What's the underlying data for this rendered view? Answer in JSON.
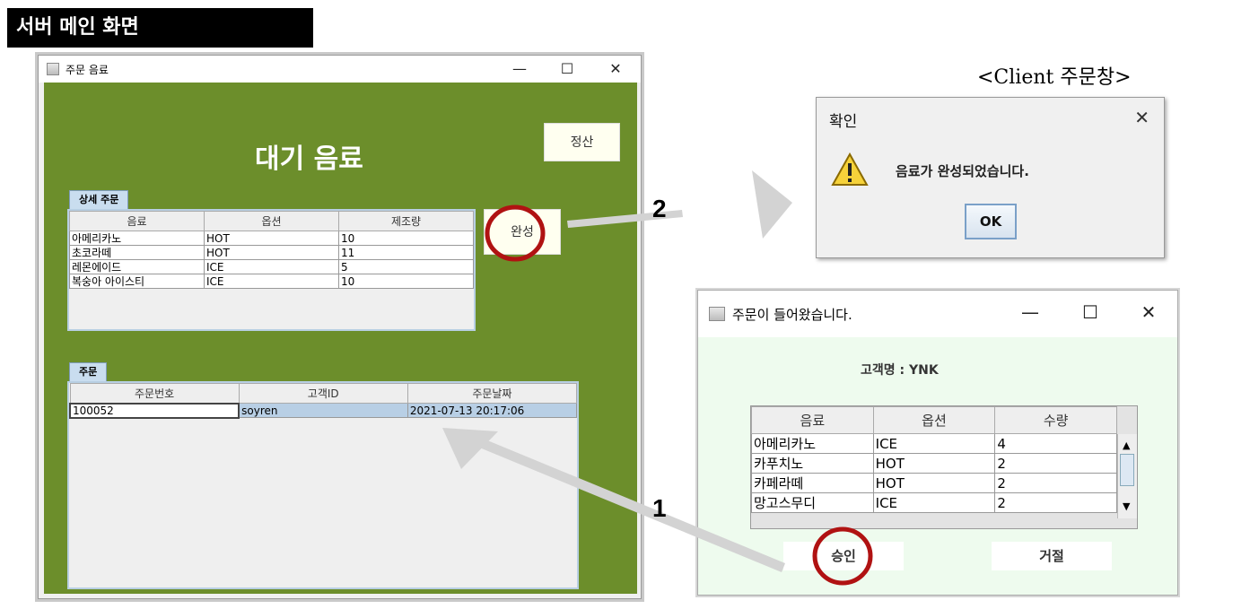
{
  "section_title": "서버 메인 화면",
  "server_window": {
    "title": "주문 음료",
    "controls": {
      "minimize": "—",
      "maximize": "☐",
      "close": "✕"
    },
    "heading": "대기 음료",
    "settle_button": "정산",
    "complete_button": "완성",
    "detail_tab": "상세 주문",
    "detail_columns": [
      "음료",
      "옵션",
      "제조량"
    ],
    "detail_rows": [
      [
        "아메리카노",
        "HOT",
        "10"
      ],
      [
        "초코라떼",
        "HOT",
        "11"
      ],
      [
        "레몬에이드",
        "ICE",
        "5"
      ],
      [
        "복숭아 아이스티",
        "ICE",
        "10"
      ]
    ],
    "order_tab": "주문",
    "order_columns": [
      "주문번호",
      "고객ID",
      "주문날짜"
    ],
    "order_rows": [
      [
        "100052",
        "soyren",
        "2021-07-13 20:17:06"
      ]
    ]
  },
  "client_label": "<Client 주문창>",
  "confirm_dialog": {
    "title": "확인",
    "close": "✕",
    "message": "음료가 완성되었습니다.",
    "ok_button": "OK"
  },
  "order_window": {
    "title": "주문이 들어왔습니다.",
    "controls": {
      "minimize": "—",
      "maximize": "☐",
      "close": "✕"
    },
    "customer": "고객명 : YNK",
    "columns": [
      "음료",
      "옵션",
      "수량"
    ],
    "rows": [
      [
        "아메리카노",
        "ICE",
        "4"
      ],
      [
        "카푸치노",
        "HOT",
        "2"
      ],
      [
        "카페라떼",
        "HOT",
        "2"
      ],
      [
        "망고스무디",
        "ICE",
        "2"
      ]
    ],
    "approve_button": "승인",
    "reject_button": "거절"
  },
  "annotations": {
    "step1": "1",
    "step2": "2"
  },
  "colors": {
    "server_bg": "#6c8e2b",
    "highlight_circle": "#b01212",
    "arrow": "#d3d3d3"
  },
  "icons": {
    "warning": "warning-icon",
    "java": "java-app-icon"
  }
}
